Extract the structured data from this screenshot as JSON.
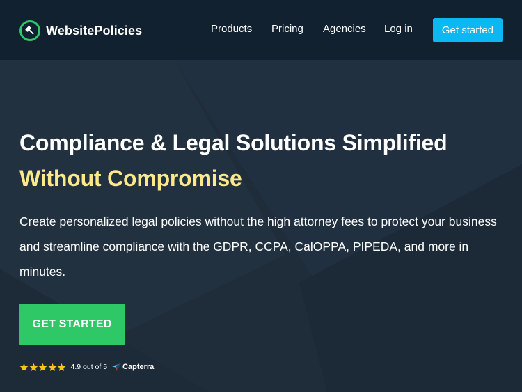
{
  "brand": {
    "name": "WebsitePolicies",
    "logo_icon": "gavel-icon",
    "accent": "#2ec866"
  },
  "nav": {
    "items": [
      {
        "label": "Products"
      },
      {
        "label": "Pricing"
      },
      {
        "label": "Agencies"
      },
      {
        "label": "Log in"
      }
    ],
    "cta_label": "Get started",
    "cta_color": "#0cb7f2"
  },
  "hero": {
    "headline": "Compliance & Legal Solutions Simplified",
    "headline_accent": "Without Compromise",
    "headline_accent_color": "#fde98c",
    "subtext": "Create personalized legal policies without the high attorney fees to protect your business and streamline compliance with the GDPR, CCPA, CalOPPA, PIPEDA, and more in minutes.",
    "cta_label": "GET STARTED",
    "cta_color": "#2ec866"
  },
  "rating": {
    "stars": 5,
    "text": "4.9 out of 5",
    "source": "Capterra",
    "star_color": "#f5c518"
  },
  "colors": {
    "header_bg": "#112130",
    "hero_bg": "#1f2d3a"
  }
}
